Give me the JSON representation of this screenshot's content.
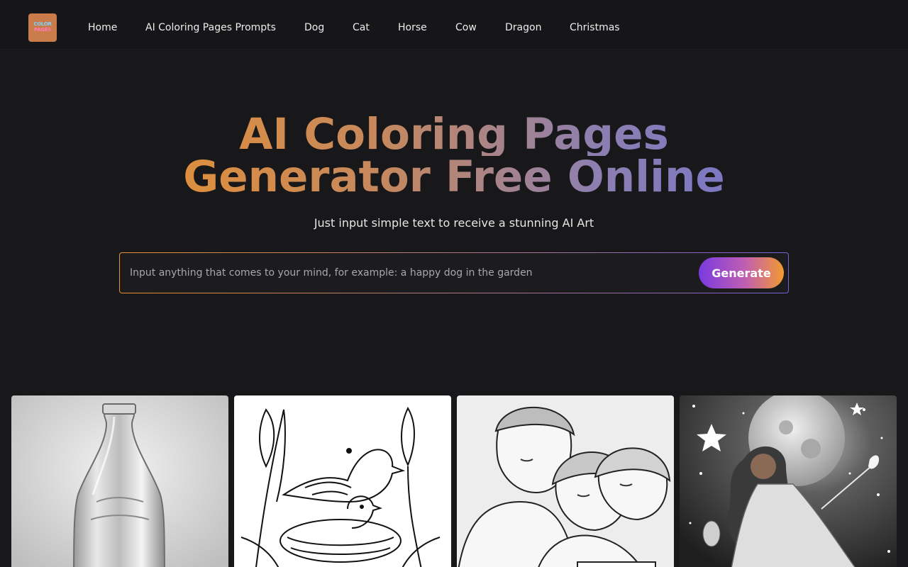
{
  "logo": {
    "line1": "COLOR",
    "line2": "PAGES"
  },
  "nav": {
    "items": [
      {
        "label": "Home"
      },
      {
        "label": "AI Coloring Pages Prompts"
      },
      {
        "label": "Dog"
      },
      {
        "label": "Cat"
      },
      {
        "label": "Horse"
      },
      {
        "label": "Cow"
      },
      {
        "label": "Dragon"
      },
      {
        "label": "Christmas"
      }
    ]
  },
  "hero": {
    "title_line1": "AI Coloring Pages",
    "title_line2": "Generator Free Online",
    "subtitle": "Just input simple text to receive a stunning AI Art"
  },
  "search": {
    "placeholder": "Input anything that comes to your mind, for example: a happy dog in the garden",
    "value": "",
    "button_label": "Generate"
  },
  "colors": {
    "background": "#18181b",
    "title_gradient_start": "#e79131",
    "title_gradient_end": "#7273cf",
    "button_gradient_start": "#7a3ae0",
    "button_gradient_end": "#f39a30"
  },
  "gallery": [
    {
      "subject": "glass-bottle-image"
    },
    {
      "subject": "bird-nest-image"
    },
    {
      "subject": "children-reading-image"
    },
    {
      "subject": "moon-girl-image"
    }
  ]
}
